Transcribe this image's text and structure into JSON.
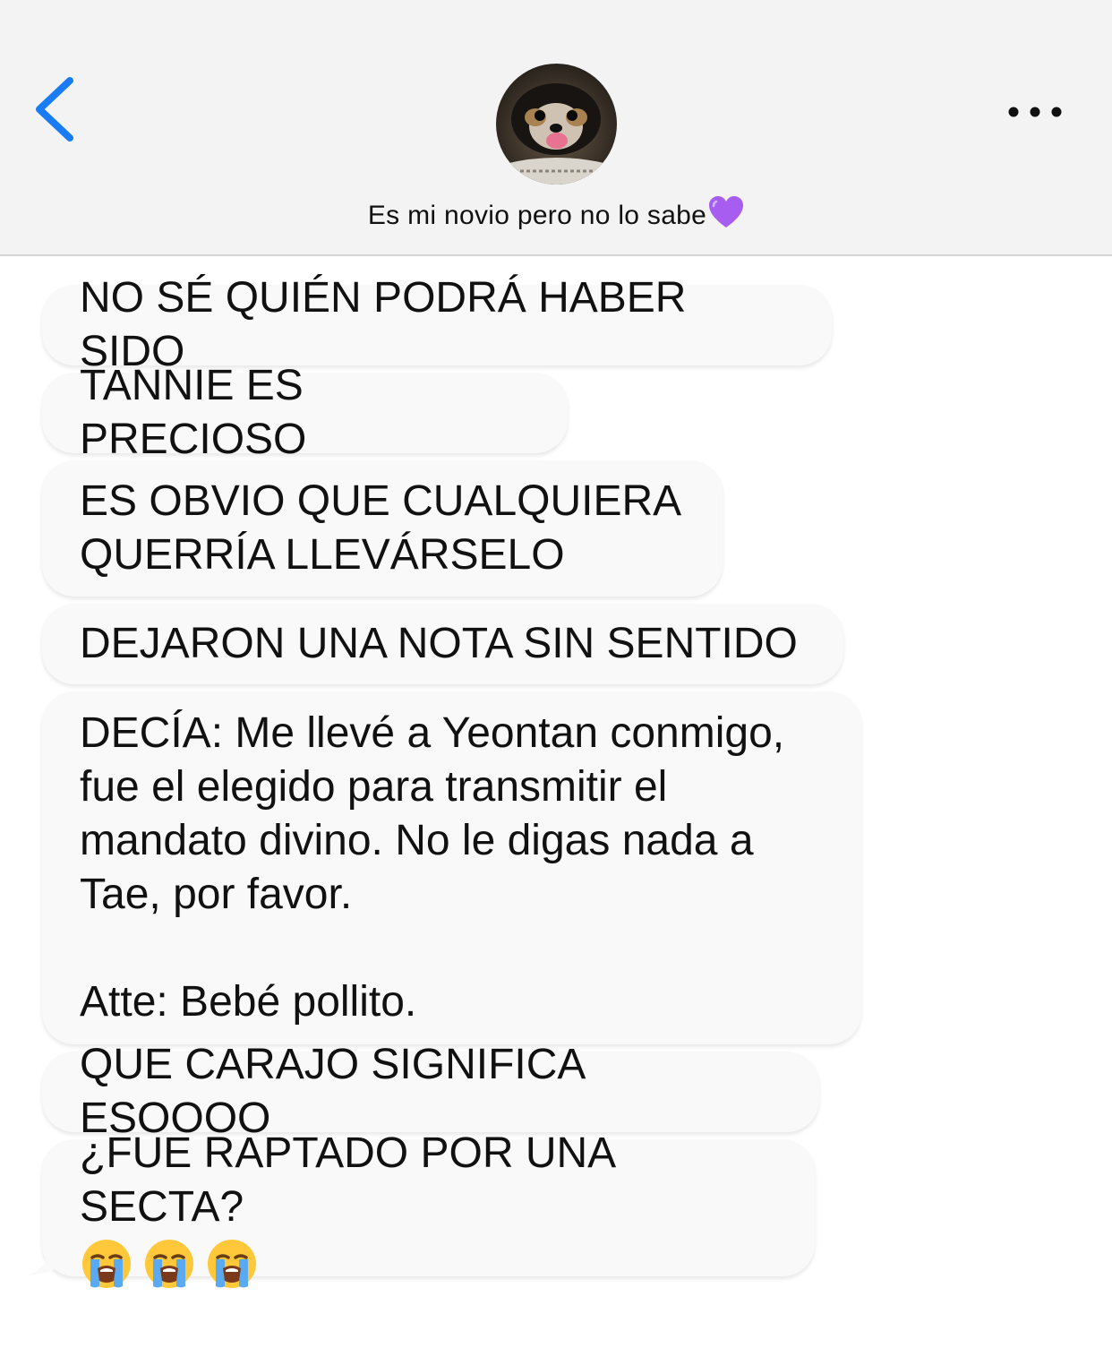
{
  "header": {
    "back_icon": "chevron-left-icon",
    "avatar_icon": "dog-avatar",
    "contact_name": "Es mi novio pero no lo sabe",
    "contact_emoji": "purple-heart",
    "more_icon": "ellipsis-icon",
    "accent_color": "#1a7cf5"
  },
  "messages": [
    {
      "text": "NO SÉ QUIÉN PODRÁ HABER SIDO"
    },
    {
      "text": "TANNIE ES PRECIOSO"
    },
    {
      "text": "ES OBVIO QUE CUALQUIERA\nQUERRÍA LLEVÁRSELO"
    },
    {
      "text": "DEJARON UNA NOTA SIN SENTIDO"
    },
    {
      "text": "DECÍA: Me llevé a Yeontan conmigo,\nfue el elegido para transmitir el\nmandato divino. No le digas nada a\nTae, por favor.\n\nAtte: Bebé pollito."
    },
    {
      "text": "QUE CARAJO SIGNIFICA ESOOOO"
    },
    {
      "text": "¿FUE RAPTADO POR UNA SECTA?",
      "emojis": [
        "loudly-crying-face",
        "loudly-crying-face",
        "loudly-crying-face"
      ]
    }
  ]
}
